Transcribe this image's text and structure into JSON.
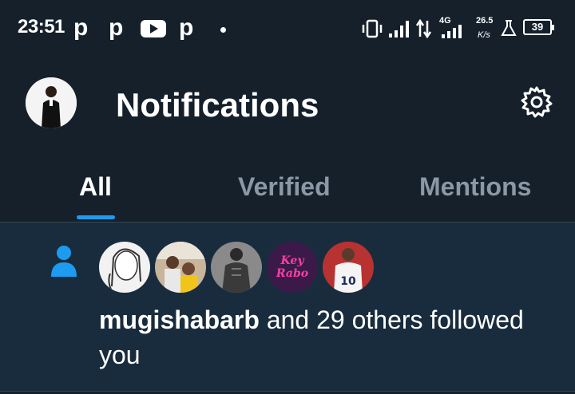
{
  "status_bar": {
    "time": "23:51",
    "app_icons": [
      "p",
      "p",
      "youtube",
      "p"
    ],
    "network_type": "4G",
    "speed": "26.5",
    "speed_unit": "K/s",
    "battery": "39"
  },
  "header": {
    "title": "Notifications"
  },
  "tabs": [
    {
      "label": "All",
      "active": true
    },
    {
      "label": "Verified",
      "active": false
    },
    {
      "label": "Mentions",
      "active": false
    }
  ],
  "notification": {
    "username": "mugishabarb",
    "rest": " and 29 others followed you",
    "avatar_count": 5
  },
  "colors": {
    "background": "#15202b",
    "accent": "#1d9bf0",
    "row_highlight": "#192c3d"
  }
}
